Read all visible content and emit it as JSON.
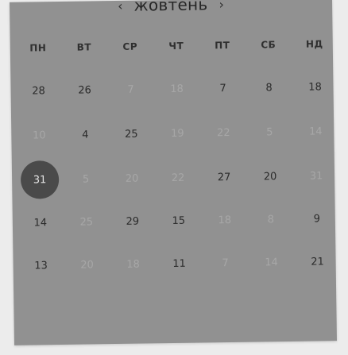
{
  "calendar": {
    "prev_icon": "‹",
    "next_icon": "›",
    "month": "жовтень",
    "weekdays": [
      "ПН",
      "ВТ",
      "СР",
      "ЧТ",
      "ПТ",
      "СБ",
      "НД"
    ],
    "weeks": [
      [
        {
          "d": "28",
          "m": false
        },
        {
          "d": "26",
          "m": false
        },
        {
          "d": "7",
          "m": true
        },
        {
          "d": "18",
          "m": true
        },
        {
          "d": "7",
          "m": false
        },
        {
          "d": "8",
          "m": false
        },
        {
          "d": "18",
          "m": false
        }
      ],
      [
        {
          "d": "10",
          "m": true
        },
        {
          "d": "4",
          "m": false
        },
        {
          "d": "25",
          "m": false
        },
        {
          "d": "19",
          "m": true
        },
        {
          "d": "22",
          "m": true
        },
        {
          "d": "5",
          "m": true
        },
        {
          "d": "14",
          "m": true
        }
      ],
      [
        {
          "d": "31",
          "m": false,
          "selected": true
        },
        {
          "d": "5",
          "m": true
        },
        {
          "d": "20",
          "m": true
        },
        {
          "d": "22",
          "m": true
        },
        {
          "d": "27",
          "m": false
        },
        {
          "d": "20",
          "m": false
        },
        {
          "d": "31",
          "m": true
        }
      ],
      [
        {
          "d": "14",
          "m": false
        },
        {
          "d": "25",
          "m": true
        },
        {
          "d": "29",
          "m": false
        },
        {
          "d": "15",
          "m": false
        },
        {
          "d": "18",
          "m": true
        },
        {
          "d": "8",
          "m": true
        },
        {
          "d": "9",
          "m": false
        }
      ],
      [
        {
          "d": "13",
          "m": false
        },
        {
          "d": "20",
          "m": true
        },
        {
          "d": "18",
          "m": true
        },
        {
          "d": "11",
          "m": false
        },
        {
          "d": "7",
          "m": true
        },
        {
          "d": "14",
          "m": true
        },
        {
          "d": "21",
          "m": false
        }
      ]
    ]
  }
}
